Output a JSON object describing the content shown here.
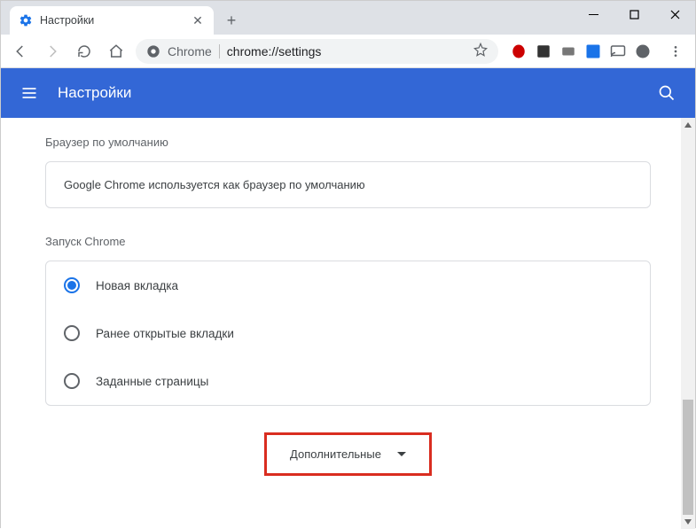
{
  "window": {
    "tab_title": "Настройки"
  },
  "omnibox": {
    "prefix": "Chrome",
    "url": "chrome://settings"
  },
  "header": {
    "title": "Настройки"
  },
  "sections": {
    "default_browser": {
      "title": "Браузер по умолчанию",
      "info": "Google Chrome используется как браузер по умолчанию"
    },
    "startup": {
      "title": "Запуск Chrome",
      "options": [
        {
          "label": "Новая вкладка",
          "selected": true
        },
        {
          "label": "Ранее открытые вкладки",
          "selected": false
        },
        {
          "label": "Заданные страницы",
          "selected": false
        }
      ]
    }
  },
  "advanced": {
    "label": "Дополнительные"
  }
}
